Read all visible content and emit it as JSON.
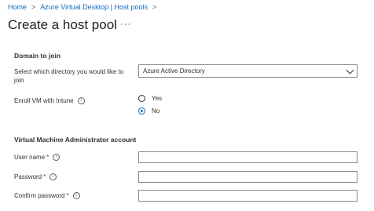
{
  "breadcrumb": {
    "items": [
      "Home",
      "Azure Virtual Desktop | Host pools"
    ],
    "separator": ">"
  },
  "page": {
    "title": "Create a host pool",
    "more_label": "···"
  },
  "domain_section": {
    "heading": "Domain to join",
    "directory_label": "Select which directory you would like to join",
    "directory_value": "Azure Active Directory",
    "intune_label": "Enroll VM with Intune",
    "intune_options": [
      "Yes",
      "No"
    ],
    "intune_selected": "No"
  },
  "admin_section": {
    "heading": "Virtual Machine Administrator account",
    "username_label": "User name",
    "password_label": "Password",
    "confirm_label": "Confirm password",
    "required_mark": "*",
    "username_value": "",
    "password_value": "",
    "confirm_value": ""
  },
  "icons": {
    "info": "info-icon",
    "chevron": "chevron-down-icon",
    "crumb_sep": "chevron-right-icon"
  },
  "colors": {
    "link": "#0f6cbd",
    "required": "#a4262c",
    "border": "#8a8886"
  }
}
